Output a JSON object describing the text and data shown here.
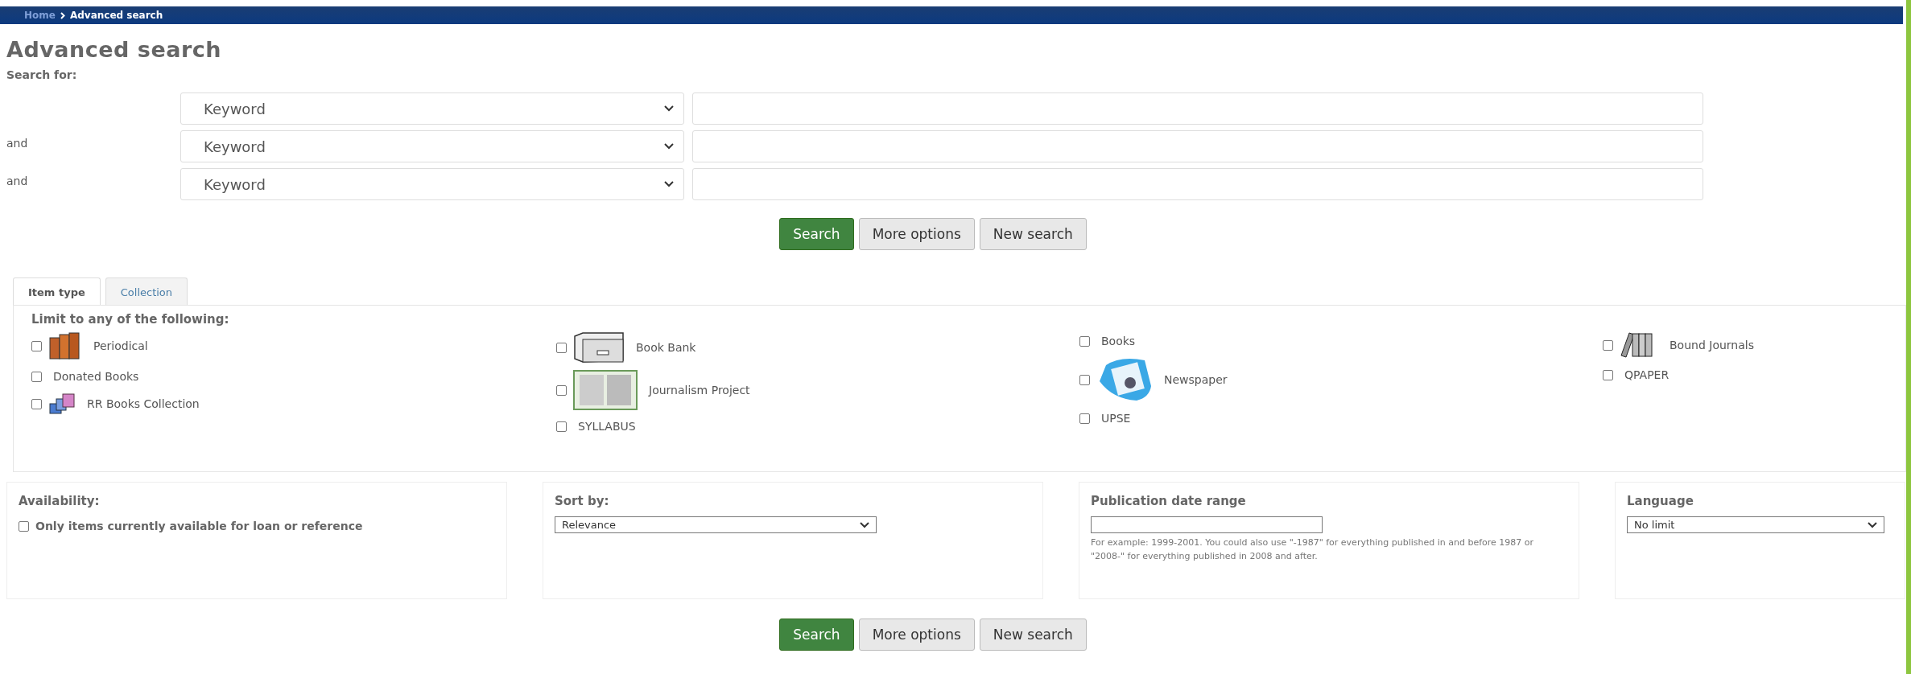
{
  "breadcrumb": [
    {
      "label": "Home",
      "current": false
    },
    {
      "label": "Advanced search",
      "current": true
    }
  ],
  "title": "Advanced search",
  "search_for_label": "Search for:",
  "search_rows": [
    {
      "index": "Keyword"
    },
    {
      "operator": "and",
      "index": "Keyword"
    },
    {
      "operator": "and",
      "index": "Keyword"
    }
  ],
  "buttons": [
    {
      "label": "Search",
      "kind": "primary"
    },
    {
      "label": "More options",
      "kind": "secondary"
    },
    {
      "label": "New search",
      "kind": "secondary"
    }
  ],
  "tabs": [
    {
      "label": "Item type",
      "selected": true
    },
    {
      "label": "Collection",
      "selected": false
    }
  ],
  "limit_heading": "Limit to any of the following:",
  "item_type_columns": [
    [
      {
        "label": "Periodical",
        "kind": "books",
        "checked": false
      },
      {
        "label": "Donated Books",
        "kind": "plain",
        "checked": false
      },
      {
        "label": "RR Books Collection",
        "kind": "stack",
        "checked": false
      }
    ],
    [
      {
        "label": "Book Bank",
        "kind": "box",
        "checked": false
      },
      {
        "label": "Journalism Project",
        "kind": "openbook",
        "checked": false
      },
      {
        "label": "SYLLABUS",
        "kind": "plain",
        "checked": false
      }
    ],
    [
      {
        "label": "Books",
        "kind": "plain",
        "checked": false
      },
      {
        "label": "Newspaper",
        "kind": "newspaper",
        "checked": false
      },
      {
        "label": "UPSE",
        "kind": "plain",
        "checked": false
      }
    ],
    [
      {
        "label": "Bound Journals",
        "kind": "binders",
        "checked": false
      },
      {
        "label": "QPAPER",
        "kind": "plain",
        "checked": false
      }
    ]
  ],
  "availability": {
    "heading": "Availability:",
    "label": "Only items currently available for loan or reference",
    "checked": false
  },
  "sort": {
    "heading": "Sort by:",
    "value": "Relevance"
  },
  "pub_date": {
    "heading": "Publication date range",
    "hint": "For example: 1999-2001. You could also use \"-1987\" for everything published in and before 1987 or \"2008-\" for everything published in 2008 and after."
  },
  "language": {
    "heading": "Language",
    "value": "No limit"
  },
  "bottom_buttons": [
    {
      "label": "Search",
      "kind": "primary"
    },
    {
      "label": "More options",
      "kind": "secondary"
    },
    {
      "label": "New search",
      "kind": "secondary"
    }
  ]
}
